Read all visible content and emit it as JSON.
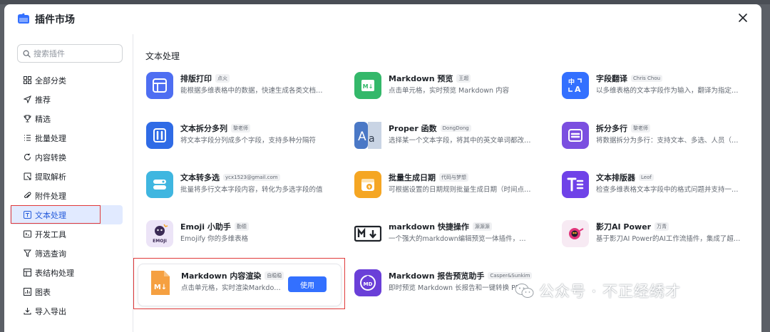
{
  "header": {
    "title": "插件市场"
  },
  "search": {
    "placeholder": "搜索插件"
  },
  "sidebar": {
    "items": [
      {
        "label": "全部分类",
        "icon": "grid-icon"
      },
      {
        "label": "推荐",
        "icon": "send-icon"
      },
      {
        "label": "精选",
        "icon": "trophy-icon"
      },
      {
        "label": "批量处理",
        "icon": "list-icon"
      },
      {
        "label": "内容转换",
        "icon": "refresh-icon"
      },
      {
        "label": "提取解析",
        "icon": "extract-icon"
      },
      {
        "label": "附件处理",
        "icon": "paperclip-icon"
      },
      {
        "label": "文本处理",
        "icon": "text-icon",
        "active": true
      },
      {
        "label": "开发工具",
        "icon": "code-icon"
      },
      {
        "label": "筛选查询",
        "icon": "filter-icon"
      },
      {
        "label": "表结构处理",
        "icon": "table-icon"
      },
      {
        "label": "图表",
        "icon": "chart-icon"
      },
      {
        "label": "导入导出",
        "icon": "import-icon"
      }
    ]
  },
  "main": {
    "section_title": "文本处理",
    "use_button_label": "使用",
    "plugins": [
      {
        "name": "排版打印",
        "author": "点火",
        "desc": "能根据多维表格中的数据，快速生成各类文档…",
        "icon": "layout-print-icon",
        "color": "#4e6ef2"
      },
      {
        "name": "Markdown 预览",
        "author": "王超",
        "desc": "点击单元格，实时预览 Markdown 内容",
        "icon": "markdown-preview-icon",
        "color": "#34b86a"
      },
      {
        "name": "字段翻译",
        "author": "Chris Chou",
        "desc": "以多维表格的文本字段作为输入，翻译为指定…",
        "icon": "translate-icon",
        "color": "#3370ff"
      },
      {
        "name": "文本拆分多列",
        "author": "黎老师",
        "desc": "将文本字段分列成多个字段，支持多种分隔符",
        "icon": "split-columns-icon",
        "color": "#2f6be6"
      },
      {
        "name": "Proper 函数",
        "author": "DongDong",
        "desc": "选择某一个文本字段，将其中的英文单词都改…",
        "icon": "proper-function-icon",
        "color": "#4a78c6"
      },
      {
        "name": "拆分多行",
        "author": "黎老师",
        "desc": "将数据拆分为多行：支持文本、多选、人员（…",
        "icon": "split-rows-icon",
        "color": "#7b4fe0"
      },
      {
        "name": "文本转多选",
        "author": "ycx1523@gmail.com",
        "desc": "批量将多行文本字段内容，转化为多选字段的值",
        "icon": "text-to-select-icon",
        "color": "#3fb6e0"
      },
      {
        "name": "批量生成日期",
        "author": "代码与梦想",
        "desc": "可根据设置的日期规则批量生成日期（时间点…",
        "icon": "calendar-icon",
        "color": "#f5a623"
      },
      {
        "name": "文本排版器",
        "author": "Leof",
        "desc": "检查多维表格文本字段中的格式问题并支持一…",
        "icon": "text-formatter-icon",
        "color": "#6f42e8"
      },
      {
        "name": "Emoji 小助手",
        "author": "勤德",
        "desc": "Emojify 你的多维表格",
        "icon": "emoji-icon",
        "color": "#ece4f7"
      },
      {
        "name": "markdown 快捷操作",
        "author": "源源源",
        "desc": "一个强大的markdown编辑预览一体插件，…",
        "icon": "markdown-quick-icon",
        "color": "#ffffff"
      },
      {
        "name": "影刀AI Power",
        "author": "万青",
        "desc": "基于影刀AI Power的AI工作流插件，集成了超…",
        "icon": "yingdao-icon",
        "color": "#f7eaf3"
      },
      {
        "name": "Markdown 内容渲染",
        "author": "自稳稳",
        "desc": "点击单元格，实时渲染Markdo…",
        "icon": "markdown-render-icon",
        "color": "#f5a041"
      },
      {
        "name": "Markdown 报告预览助手",
        "author": "Casper&Sunkim",
        "desc": "即时预览 Markdown 长报告和一键转换 PDF…",
        "icon": "md-report-icon",
        "color": "#6a3fd8"
      }
    ]
  },
  "watermark": {
    "text": "公众号 · 不正经绣才"
  }
}
